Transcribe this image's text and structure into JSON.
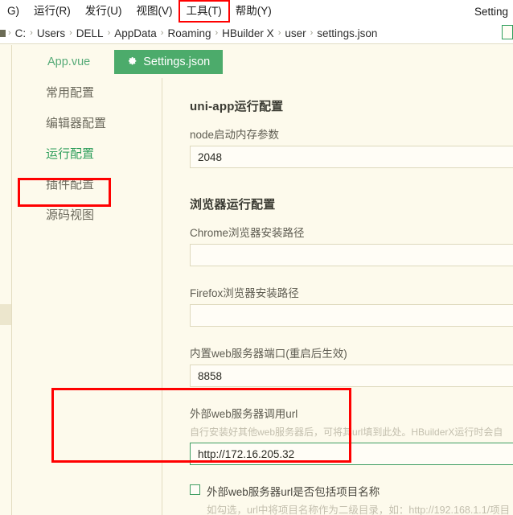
{
  "menubar": {
    "items": [
      {
        "label": "G)",
        "mnemonic": "",
        "highlighted": false
      },
      {
        "label": "运行(R)",
        "mnemonic": "R",
        "highlighted": false
      },
      {
        "label": "发行(U)",
        "mnemonic": "U",
        "highlighted": false
      },
      {
        "label": "视图(V)",
        "mnemonic": "V",
        "highlighted": false
      },
      {
        "label": "工具(T)",
        "mnemonic": "T",
        "highlighted": true
      },
      {
        "label": "帮助(Y)",
        "mnemonic": "Y",
        "highlighted": false
      }
    ],
    "right_label": "Setting"
  },
  "breadcrumb": {
    "segments": [
      "C:",
      "Users",
      "DELL",
      "AppData",
      "Roaming",
      "HBuilder X",
      "user",
      "settings.json"
    ],
    "separator": "›"
  },
  "tabs": [
    {
      "label": "App.vue",
      "active": false,
      "icon": ""
    },
    {
      "label": "Settings.json",
      "active": true,
      "icon": "gear-icon"
    }
  ],
  "sidebar": {
    "items": [
      {
        "label": "常用配置",
        "active": false
      },
      {
        "label": "编辑器配置",
        "active": false
      },
      {
        "label": "运行配置",
        "active": true
      },
      {
        "label": "插件配置",
        "active": false
      },
      {
        "label": "源码视图",
        "active": false
      }
    ]
  },
  "content": {
    "section_uniapp": {
      "title": "uni-app运行配置",
      "fields": [
        {
          "label": "node启动内存参数",
          "value": "2048",
          "hint": "",
          "focused": false
        }
      ]
    },
    "section_browser": {
      "title": "浏览器运行配置",
      "fields": [
        {
          "label": "Chrome浏览器安装路径",
          "value": "",
          "hint": "",
          "focused": false
        },
        {
          "label": "Firefox浏览器安装路径",
          "value": "",
          "hint": "",
          "focused": false
        },
        {
          "label": "内置web服务器端口(重启后生效)",
          "value": "8858",
          "hint": "",
          "focused": false
        },
        {
          "label": "外部web服务器调用url",
          "value": "http://172.16.205.32",
          "hint": "自行安装好其他web服务器后，可将其url填到此处。HBuilderX运行时会自",
          "focused": true
        }
      ],
      "checkbox": {
        "checked": false,
        "label": "外部web服务器url是否包括项目名称",
        "sub": "如勾选，url中将项目名称作为二级目录，如：http://192.168.1.1/项目"
      }
    }
  },
  "annotations": {
    "highlight_color": "#ff0000",
    "accent_green": "#4cab6b",
    "background": "#fdfaec"
  }
}
